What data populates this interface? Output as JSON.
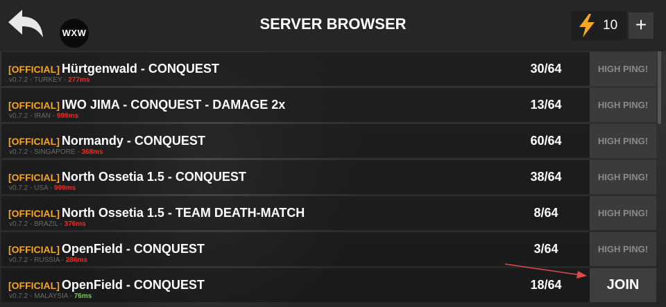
{
  "header": {
    "title": "SERVER BROWSER",
    "avatar_text": "WXW",
    "energy_count": "10",
    "add_label": "+"
  },
  "colors": {
    "official": "#f5a623",
    "ping_bad": "#ff2222",
    "ping_good": "#6fd13a",
    "energy_bolt": "#f5a623"
  },
  "icons": {
    "back": "back-arrow-icon",
    "energy": "lightning-bolt-icon"
  },
  "servers": [
    {
      "tag": "[OFFICIAL]",
      "name": "Hürtgenwald - CONQUEST",
      "meta": "v0.7.2 - TURKEY - ",
      "ping": "277ms",
      "players": "30/64",
      "action": "HIGH PING!"
    },
    {
      "tag": "[OFFICIAL]",
      "name": "IWO JIMA - CONQUEST - DAMAGE 2x",
      "meta": "v0.7.2 - IRAN - ",
      "ping": "999ms",
      "players": "13/64",
      "action": "HIGH PING!"
    },
    {
      "tag": "[OFFICIAL]",
      "name": "Normandy - CONQUEST",
      "meta": "v0.7.2 - SINGAPORE - ",
      "ping": "368ms",
      "players": "60/64",
      "action": "HIGH PING!"
    },
    {
      "tag": "[OFFICIAL]",
      "name": "North Ossetia 1.5 - CONQUEST",
      "meta": "v0.7.2 - USA - ",
      "ping": "999ms",
      "players": "38/64",
      "action": "HIGH PING!"
    },
    {
      "tag": "[OFFICIAL]",
      "name": "North Ossetia 1.5 - TEAM DEATH-MATCH",
      "meta": "v0.7.2 - BRAZIL - ",
      "ping": "376ms",
      "players": "8/64",
      "action": "HIGH PING!"
    },
    {
      "tag": "[OFFICIAL]",
      "name": "OpenField - CONQUEST",
      "meta": "v0.7.2 - RUSSIA - ",
      "ping": "286ms",
      "players": "3/64",
      "action": "HIGH PING!"
    },
    {
      "tag": "[OFFICIAL]",
      "name": "OpenField - CONQUEST",
      "meta": "v0.7.2 - MALAYSIA - ",
      "ping": "76ms",
      "players": "18/64",
      "action": "JOIN"
    }
  ]
}
